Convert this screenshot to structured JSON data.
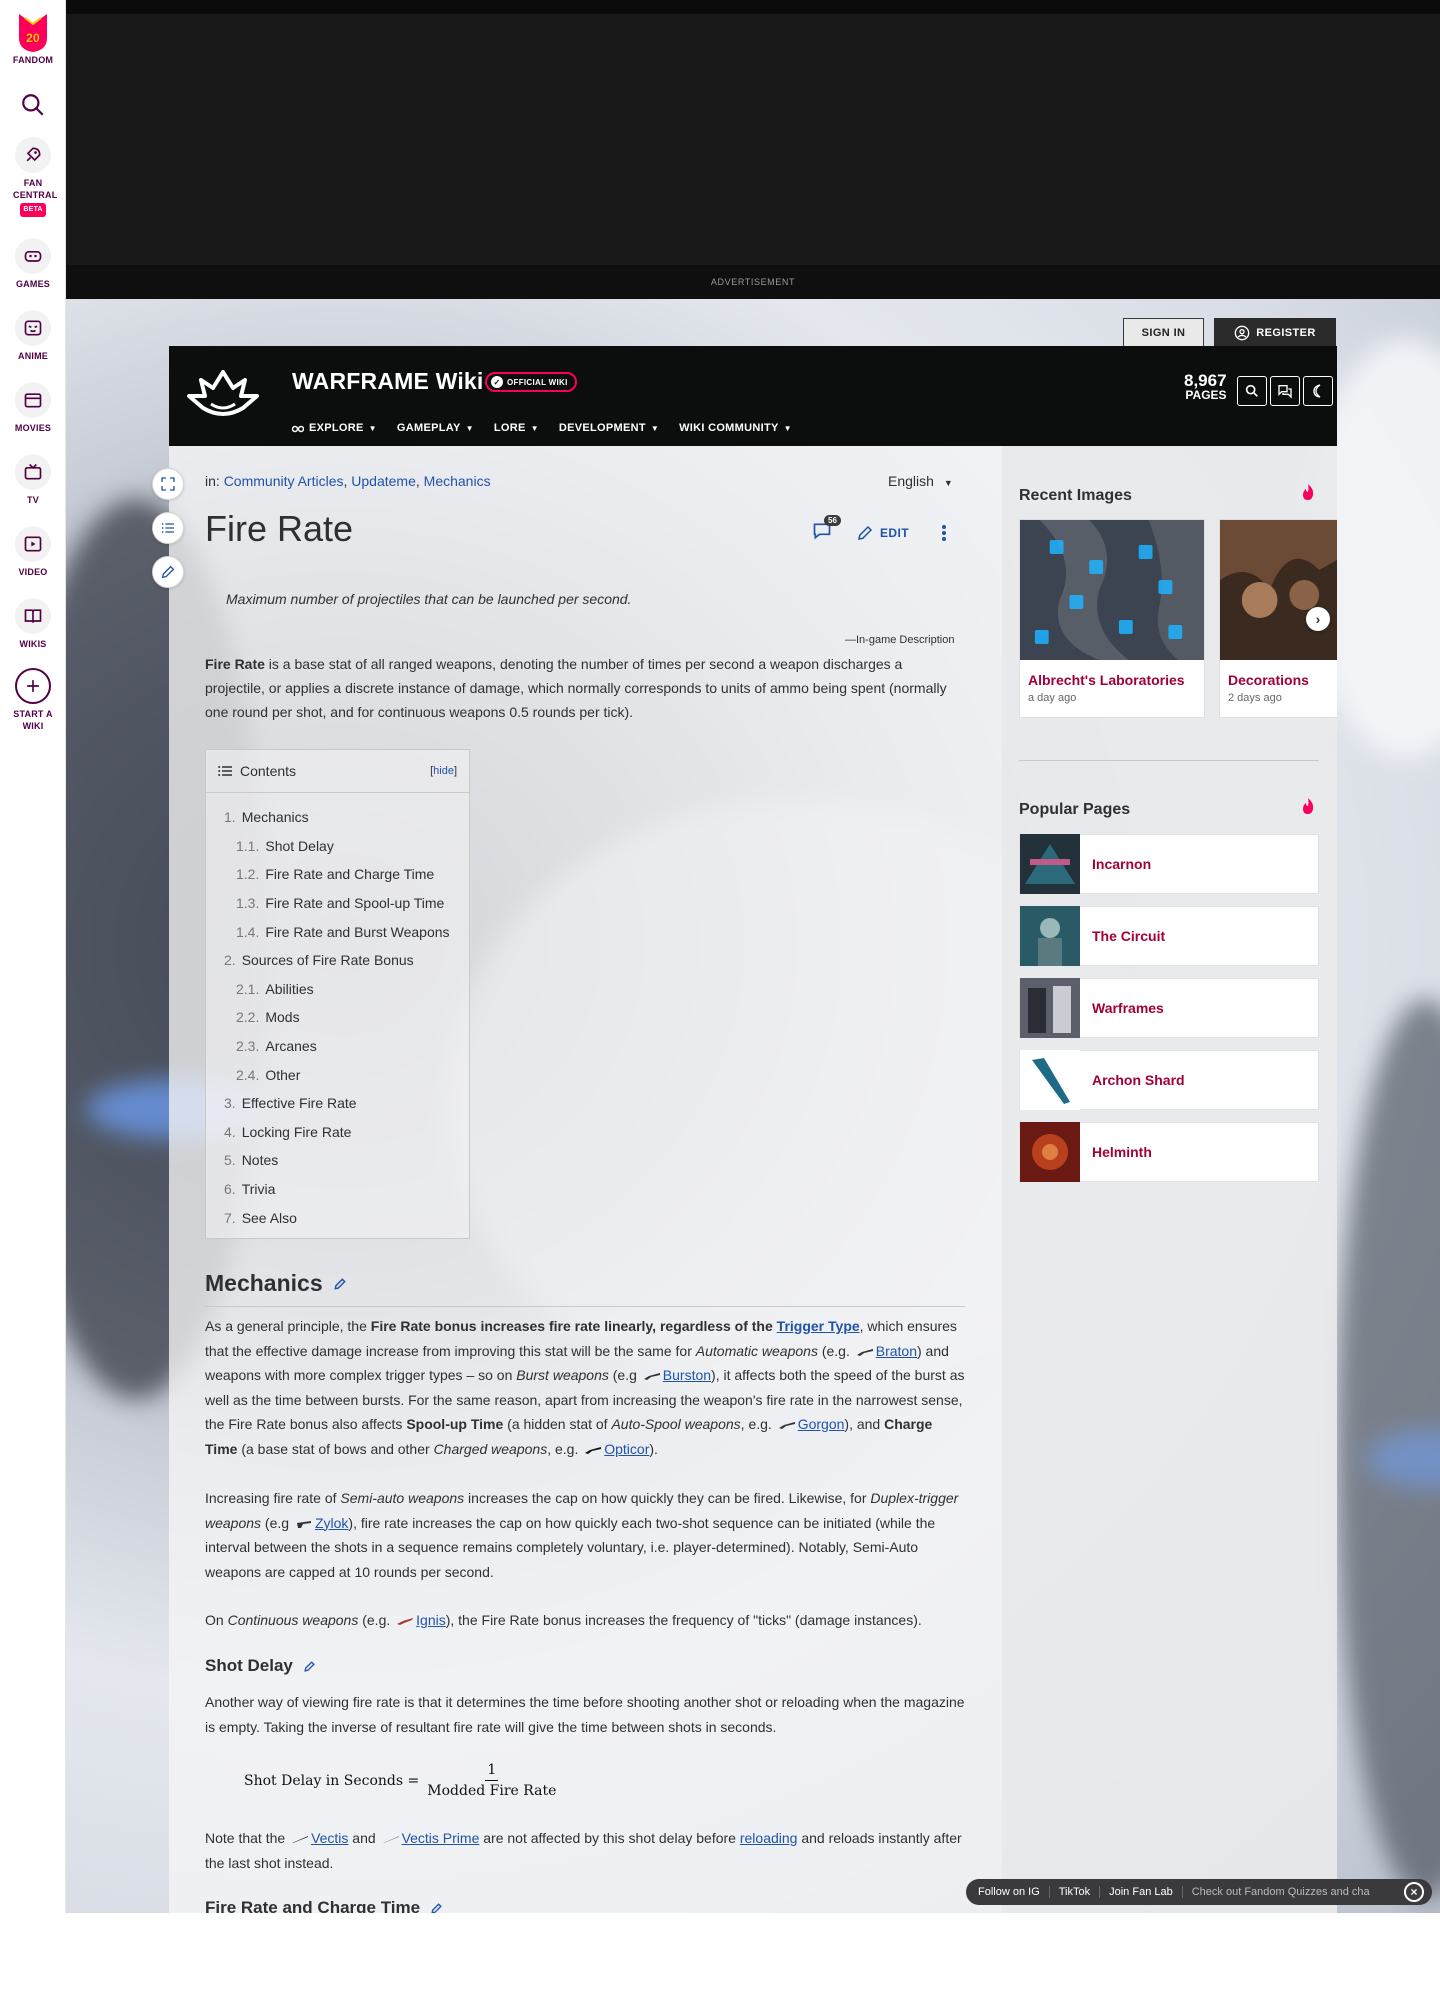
{
  "global_nav": {
    "fandom_label": "FANDOM",
    "fandom_badge": "20",
    "items": [
      {
        "label": "FAN CENTRAL",
        "icon": "rocket-icon",
        "badge": "BETA"
      },
      {
        "label": "GAMES",
        "icon": "gamepad-icon"
      },
      {
        "label": "ANIME",
        "icon": "anime-face-icon"
      },
      {
        "label": "MOVIES",
        "icon": "movie-icon"
      },
      {
        "label": "TV",
        "icon": "tv-icon"
      },
      {
        "label": "VIDEO",
        "icon": "play-icon"
      },
      {
        "label": "WIKIS",
        "icon": "book-icon"
      },
      {
        "label": "START A WIKI",
        "icon": "plus-icon"
      }
    ]
  },
  "ad": {
    "label": "ADVERTISEMENT"
  },
  "auth": {
    "sign_in": "SIGN IN",
    "register": "REGISTER"
  },
  "wiki_header": {
    "title": "WARFRAME Wiki",
    "badge": "OFFICIAL WIKI",
    "nav": [
      "EXPLORE",
      "GAMEPLAY",
      "LORE",
      "DEVELOPMENT",
      "WIKI COMMUNITY"
    ],
    "pages_count": "8,967",
    "pages_label": "PAGES"
  },
  "article": {
    "categories_prefix": "in:",
    "categories": [
      "Community Articles",
      "Updateme",
      "Mechanics"
    ],
    "language": "English",
    "title": "Fire Rate",
    "comment_count": "56",
    "edit_label": "EDIT",
    "quote": "Maximum number of projectiles that can be launched per second.",
    "quote_source": "—In-game Description",
    "intro_bold": "Fire Rate",
    "intro_rest": " is a base stat of all ranged weapons, denoting the number of times per second a weapon discharges a projectile, or applies a discrete instance of damage, which normally corresponds to units of ammo being spent (normally one round per shot, and for continuous weapons 0.5 rounds per tick).",
    "toc": {
      "title": "Contents",
      "hide_label": "hide",
      "items": [
        {
          "num": "1.",
          "text": "Mechanics",
          "level": 1
        },
        {
          "num": "1.1.",
          "text": "Shot Delay",
          "level": 2
        },
        {
          "num": "1.2.",
          "text": "Fire Rate and Charge Time",
          "level": 2
        },
        {
          "num": "1.3.",
          "text": "Fire Rate and Spool-up Time",
          "level": 2
        },
        {
          "num": "1.4.",
          "text": "Fire Rate and Burst Weapons",
          "level": 2
        },
        {
          "num": "2.",
          "text": "Sources of Fire Rate Bonus",
          "level": 1
        },
        {
          "num": "2.1.",
          "text": "Abilities",
          "level": 2
        },
        {
          "num": "2.2.",
          "text": "Mods",
          "level": 2
        },
        {
          "num": "2.3.",
          "text": "Arcanes",
          "level": 2
        },
        {
          "num": "2.4.",
          "text": "Other",
          "level": 2
        },
        {
          "num": "3.",
          "text": "Effective Fire Rate",
          "level": 1
        },
        {
          "num": "4.",
          "text": "Locking Fire Rate",
          "level": 1
        },
        {
          "num": "5.",
          "text": "Notes",
          "level": 1
        },
        {
          "num": "6.",
          "text": "Trivia",
          "level": 1
        },
        {
          "num": "7.",
          "text": "See Also",
          "level": 1
        }
      ]
    },
    "mechanics": {
      "heading": "Mechanics",
      "p1": {
        "a": "As a general principle, the ",
        "b": "Fire Rate bonus increases fire rate linearly, regardless of the ",
        "link_trigger": "Trigger Type",
        "c": ", which ensures that the effective damage increase from improving this stat will be the same for ",
        "d": "Automatic weapons",
        "e": " (e.g. ",
        "link_braton": "Braton",
        "f": ") and weapons with more complex trigger types – so on ",
        "g": "Burst weapons",
        "h": " (e.g ",
        "link_burston": "Burston",
        "i": "), it affects both the speed of the burst as well as the time between bursts. For the same reason, apart from increasing the weapon's fire rate in the narrowest sense, the Fire Rate bonus also affects ",
        "j": "Spool-up Time",
        "k": " (a hidden stat of ",
        "l": "Auto-Spool weapons",
        "m": ", e.g. ",
        "link_gorgon": "Gorgon",
        "n": "), and ",
        "o": "Charge Time",
        "p": " (a base stat of bows and other ",
        "q": "Charged weapons",
        "r": ", e.g. ",
        "link_opticor": "Opticor",
        "s": ")."
      },
      "p2": {
        "a": "Increasing fire rate of ",
        "b": "Semi-auto weapons",
        "c": " increases the cap on how quickly they can be fired. Likewise, for ",
        "d": "Duplex-trigger weapons",
        "e": " (e.g ",
        "link_zylok": "Zylok",
        "f": "), fire rate increases the cap on how quickly each two-shot sequence can be initiated (while the interval between the shots in a sequence remains completely voluntary, i.e. player-determined). Notably, Semi-Auto weapons are capped at 10 rounds per second."
      },
      "p3": {
        "a": "On ",
        "b": "Continuous weapons",
        "c": " (e.g. ",
        "link_ignis": "Ignis",
        "d": "), the Fire Rate bonus increases the frequency of \"ticks\" (damage instances)."
      }
    },
    "shot_delay": {
      "heading": "Shot Delay",
      "p1": "Another way of viewing fire rate is that it determines the time before shooting another shot or reloading when the magazine is empty. Taking the inverse of resultant fire rate will give the time between shots in seconds.",
      "formula_lhs": "Shot Delay in Seconds =",
      "formula_num": "1",
      "formula_den": "Modded Fire Rate",
      "p2": {
        "a": "Note that the ",
        "link_vectis": "Vectis",
        "b": " and ",
        "link_vectis_prime": "Vectis Prime",
        "c": " are not affected by this shot delay before ",
        "link_reloading": "reloading",
        "d": " and reloads instantly after the last shot instead."
      }
    },
    "next_heading": "Fire Rate and Charge Time"
  },
  "rail": {
    "recent_images": {
      "title": "Recent Images",
      "cards": [
        {
          "title": "Albrecht's Laboratories",
          "time": "a day ago"
        },
        {
          "title": "Decorations",
          "time": "2 days ago"
        }
      ]
    },
    "popular_pages": {
      "title": "Popular Pages",
      "items": [
        "Incarnon",
        "The Circuit",
        "Warframes",
        "Archon Shard",
        "Helminth"
      ]
    }
  },
  "fan_bar": {
    "links": [
      "Follow on IG",
      "TikTok",
      "Join Fan Lab"
    ],
    "ticker": "Check out Fandom Quizzes and cha"
  },
  "colors": {
    "fandom_pink": "#fa005a",
    "link_blue": "#1f53a8",
    "rail_link": "#a0003b",
    "header_bg": "#0b0e0d"
  }
}
